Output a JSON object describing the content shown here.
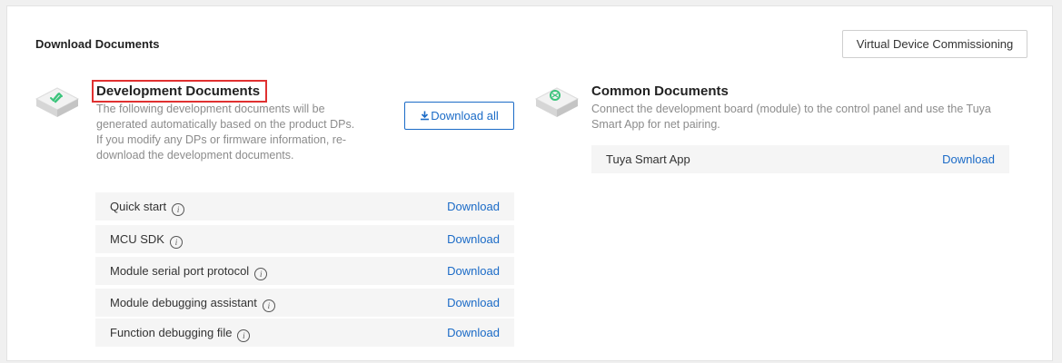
{
  "panel": {
    "title": "Download Documents",
    "virtual_device_button": "Virtual Device Commissioning"
  },
  "development": {
    "title": "Development Documents",
    "description": "The following development documents will be generated automatically based on the product DPs. If you modify any DPs or firmware information, re-download the development documents.",
    "download_all_label": "Download all",
    "download_all_icon": "download-icon",
    "items": [
      {
        "name": "Quick start",
        "icon": "info-icon",
        "link": "Download"
      },
      {
        "name": "MCU SDK",
        "icon": "info-icon",
        "link": "Download"
      },
      {
        "name": "Module serial port protocol",
        "icon": "info-icon",
        "link": "Download"
      },
      {
        "name": "Module debugging assistant",
        "icon": "info-icon",
        "link": "Download"
      },
      {
        "name": "Function debugging file",
        "icon": "info-icon",
        "link": "Download"
      }
    ]
  },
  "common": {
    "title": "Common Documents",
    "description": "Connect the development board (module) to the control panel and use the Tuya Smart App for net pairing.",
    "items": [
      {
        "name": "Tuya Smart App",
        "link": "Download"
      }
    ]
  },
  "colors": {
    "accent": "#1b6bc7",
    "highlight_border": "#e03030",
    "icon_green": "#3cc47c"
  }
}
